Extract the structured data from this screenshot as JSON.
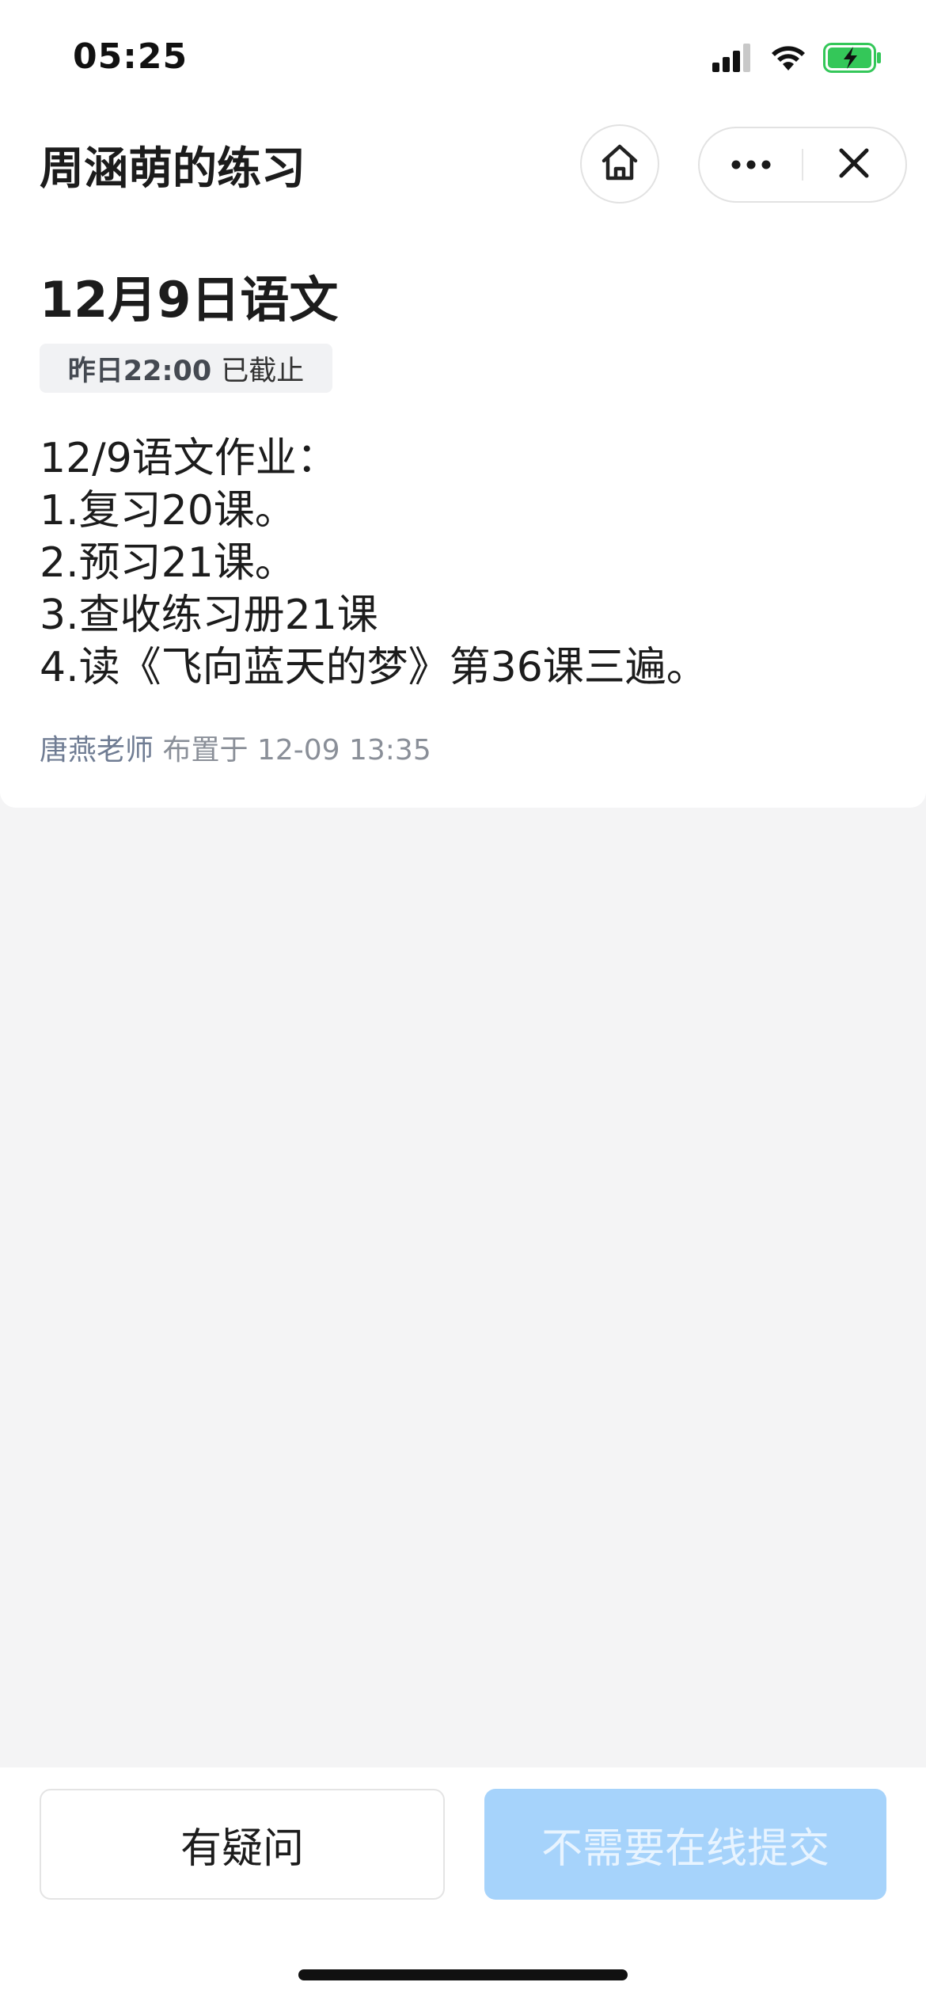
{
  "status_bar": {
    "time": "05:25",
    "icons": [
      "signal-icon",
      "wifi-icon",
      "battery-charging-icon"
    ],
    "battery_color": "#34c759"
  },
  "nav": {
    "title": "周涵萌的练习",
    "home_icon": "home-icon",
    "more_icon": "more-dots-icon",
    "close_icon": "close-icon"
  },
  "homework": {
    "title": "12月9日语文",
    "deadline_time": "昨日22:00",
    "deadline_status": "已截止",
    "content_lines": [
      "12/9语文作业：",
      "1.复习20课。",
      "2.预习21课。",
      "3.查收练习册21课",
      "4.读《飞向蓝天的梦》第36课三遍。"
    ],
    "teacher": "唐燕老师",
    "assigned_label": "布置于",
    "assigned_time": "12-09 13:35"
  },
  "actions": {
    "question_label": "有疑问",
    "submit_label": "不需要在线提交",
    "submit_color": "#a6d3fb"
  }
}
